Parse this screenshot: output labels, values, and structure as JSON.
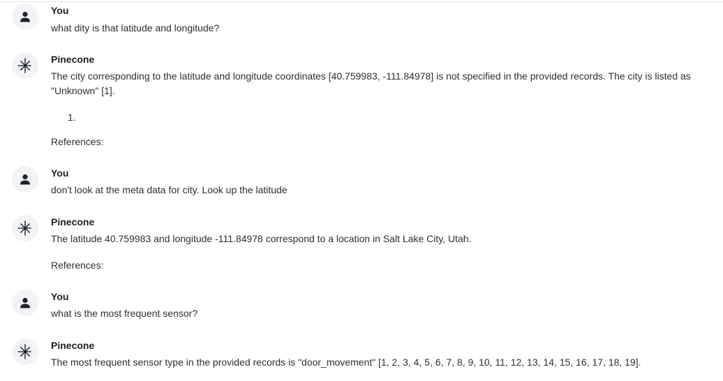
{
  "messages": [
    {
      "sender": "You",
      "text": "what dity is that latitude and longitude?"
    },
    {
      "sender": "Pinecone",
      "text": "The city corresponding to the latitude and longitude coordinates [40.759983, -111.84978] is not specified in the provided records. The city is listed as \"Unknown\" [1].",
      "list_item": "1.",
      "references_label": "References:"
    },
    {
      "sender": "You",
      "text": "don't look at the meta data for city. Look up the latitude"
    },
    {
      "sender": "Pinecone",
      "text": "The latitude 40.759983 and longitude -111.84978 correspond to a location in Salt Lake City, Utah.",
      "references_label": "References:"
    },
    {
      "sender": "You",
      "text": "what is the most frequent sensor?"
    },
    {
      "sender": "Pinecone",
      "text": "The most frequent sensor type in the provided records is \"door_movement\" [1, 2, 3, 4, 5, 6, 7, 8, 9, 10, 11, 12, 13, 14, 15, 16, 17, 18, 19]."
    }
  ],
  "icons": {
    "user": "person-icon",
    "assistant": "pinecone-logo-icon"
  }
}
